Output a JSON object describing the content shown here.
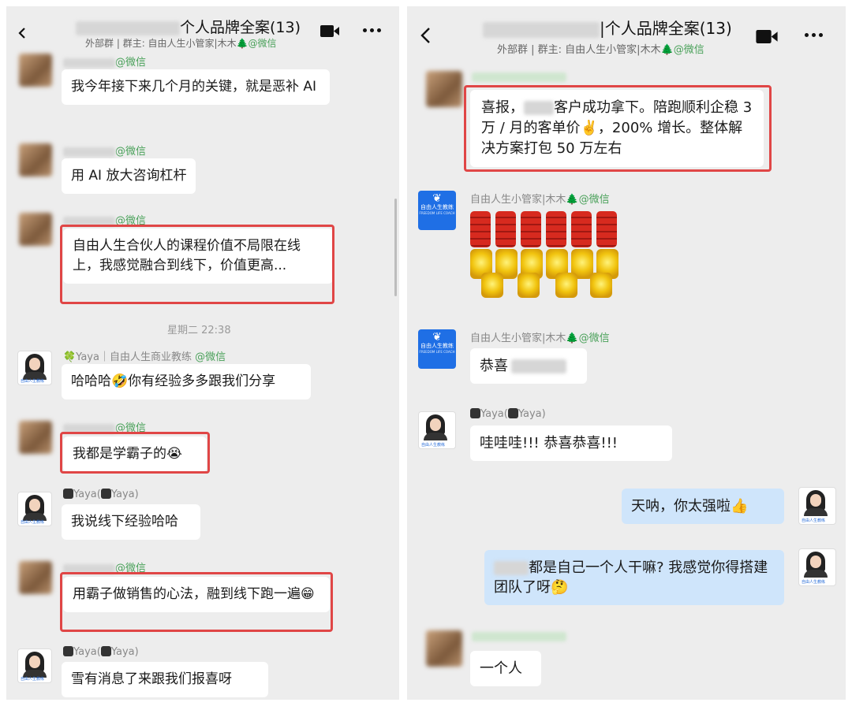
{
  "left": {
    "title": "个人品牌全案(13)",
    "subtitle": {
      "prefix": "外部群",
      "owner": "群主: 自由人生小管家|木木🌲",
      "tag": "@微信"
    },
    "messages": [
      {
        "name_tag": "@微信",
        "text": "我今年接下来几个月的关键，就是恶补 AI"
      },
      {
        "name_tag": "@微信",
        "text": "用 AI 放大咨询杠杆"
      },
      {
        "name_tag": "@微信",
        "text": "自由人生合伙人的课程价值不局限在线上，我感觉融合到线下，价值更高..."
      },
      {
        "name": "🍀Yaya｜自由人生商业教练",
        "name_tag": "@微信",
        "text": "哈哈哈🤣你有经验多多跟我们分享"
      },
      {
        "name_tag": "@微信",
        "text": "我都是学霸子的😭"
      },
      {
        "name": "Yaya(",
        "name2": "Yaya)",
        "text": "我说线下经验哈哈"
      },
      {
        "name_tag": "@微信",
        "text": "用霸子做销售的心法，融到线下跑一遍😁"
      },
      {
        "name": "Yaya(",
        "name2": "Yaya)",
        "text": "雪有消息了来跟我们报喜呀"
      }
    ],
    "timestamp": "星期二 22:38",
    "avatar_logo": "自由人生教练"
  },
  "right": {
    "title": "|个人品牌全案(13)",
    "subtitle": {
      "prefix": "外部群",
      "owner": "群主: 自由人生小管家|木木🌲",
      "tag": "@微信"
    },
    "messages": [
      {
        "text_a": "喜报，",
        "text_b": "客户成功拿下。陪跑顺利企稳 3 万 / 月的客单价✌️，200% 增长。整体解决方案打包 50 万左右"
      },
      {
        "name": "自由人生小管家|木木🌲",
        "name_tag": "@微信"
      },
      {
        "name": "自由人生小管家|木木🌲",
        "name_tag": "@微信",
        "text": "恭喜"
      },
      {
        "name": "Yaya(",
        "name2": "Yaya)",
        "text": "哇哇哇!!! 恭喜恭喜!!!"
      },
      {
        "text": "天呐，你太强啦👍"
      },
      {
        "text": "都是自己一个人干嘛? 我感觉你得搭建团队了呀🤔"
      },
      {
        "text": "一个人"
      }
    ],
    "logo": {
      "line1": "自由人生教练",
      "line2": "FREEDOM LIFE COACH"
    }
  },
  "icons": [
    "back-arrow-icon",
    "video-call-icon",
    "more-icon"
  ]
}
